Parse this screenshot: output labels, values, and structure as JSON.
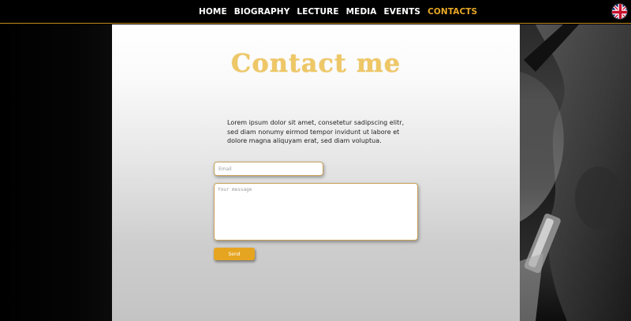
{
  "nav": {
    "items": [
      {
        "label": "HOME",
        "active": false
      },
      {
        "label": "BIOGRAPHY",
        "active": false
      },
      {
        "label": "LECTURE",
        "active": false
      },
      {
        "label": "MEDIA",
        "active": false
      },
      {
        "label": "EVENTS",
        "active": false
      },
      {
        "label": "CONTACTS",
        "active": true
      }
    ],
    "language_flag": "uk-flag-icon"
  },
  "contact": {
    "title": "Contact me",
    "intro": "Lorem ipsum dolor sit amet, consetetur sadipscing elitr, sed diam nonumy eirmod tempor invidunt ut labore et dolore magna aliquyam erat, sed diam voluptua.",
    "email_placeholder": "Email",
    "message_placeholder": "Your message",
    "send_label": "Send"
  },
  "colors": {
    "accent": "#e9a927",
    "title": "#eec766",
    "background": "#000000"
  }
}
